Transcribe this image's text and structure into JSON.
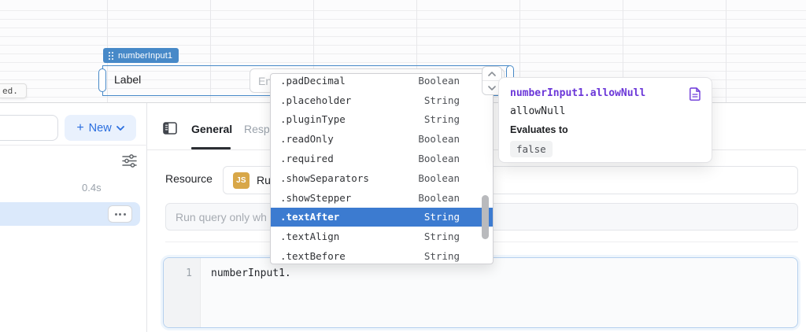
{
  "canvas": {
    "edge_tooltip_text": "ed.",
    "component": {
      "tag_label": "numberInput1",
      "label": "Label",
      "input_placeholder": "En"
    }
  },
  "autocomplete": {
    "items": [
      {
        "name": ".padDecimal",
        "type": "Boolean",
        "selected": false
      },
      {
        "name": ".placeholder",
        "type": "String",
        "selected": false
      },
      {
        "name": ".pluginType",
        "type": "String",
        "selected": false
      },
      {
        "name": ".readOnly",
        "type": "Boolean",
        "selected": false
      },
      {
        "name": ".required",
        "type": "Boolean",
        "selected": false
      },
      {
        "name": ".showSeparators",
        "type": "Boolean",
        "selected": false
      },
      {
        "name": ".showStepper",
        "type": "Boolean",
        "selected": false
      },
      {
        "name": ".textAfter",
        "type": "String",
        "selected": true
      },
      {
        "name": ".textAlign",
        "type": "String",
        "selected": false
      },
      {
        "name": ".textBefore",
        "type": "String",
        "selected": false
      }
    ]
  },
  "evaluation_popover": {
    "title": "numberInput1.allowNull",
    "property": "allowNull",
    "evaluates_label": "Evaluates to",
    "value": "false"
  },
  "query_panel": {
    "new_button_plus": "+",
    "new_button_label": "New",
    "duration": "0.4s"
  },
  "editor": {
    "tabs": [
      {
        "label": "General",
        "active": true
      },
      {
        "label": "Response",
        "active": false
      }
    ],
    "resource_label": "Resource",
    "resource_badge": "JS",
    "resource_name": "Ru",
    "trigger_placeholder": "Run query only wh",
    "code_line_number": "1",
    "code_content": "numberInput1."
  },
  "colors": {
    "selection_blue": "#4789c8",
    "highlight_blue": "#3c7bd0",
    "popover_purple": "#6b37d8",
    "accent_blue": "#2a6edf",
    "js_badge_gold": "#d8a748",
    "selected_row_bg": "#dbe9fb"
  }
}
